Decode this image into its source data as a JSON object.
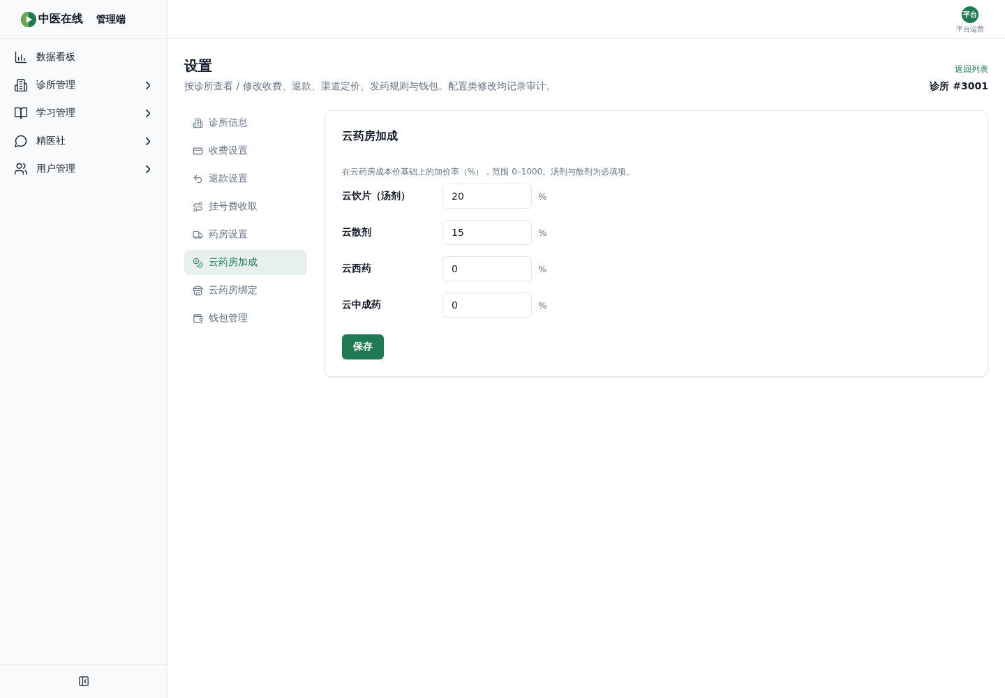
{
  "sidebar": {
    "brand": {
      "name": "中医在线",
      "suffix": "管理端"
    },
    "items": [
      {
        "label": "数据看板",
        "expandable": false
      },
      {
        "label": "诊所管理",
        "expandable": true
      },
      {
        "label": "学习管理",
        "expandable": true
      },
      {
        "label": "精医社",
        "expandable": true
      },
      {
        "label": "用户管理",
        "expandable": true
      }
    ]
  },
  "top_bar": {
    "avatar": {
      "badge": "平台",
      "role": "平台运营"
    }
  },
  "page": {
    "title": "设置",
    "subtitle": "按诊所查看 / 修改收费、退款、渠道定价、发药规则与钱包。配置类修改均记录审计。",
    "back_link": "返回列表",
    "clinic": "诊所 #3001"
  },
  "settings_nav": [
    {
      "label": "诊所信息",
      "selected": false
    },
    {
      "label": "收费设置",
      "selected": false
    },
    {
      "label": "退款设置",
      "selected": false
    },
    {
      "label": "挂号费收取",
      "selected": false
    },
    {
      "label": "药房设置",
      "selected": false
    },
    {
      "label": "云药房加成",
      "selected": true
    },
    {
      "label": "云药房绑定",
      "selected": false
    },
    {
      "label": "钱包管理",
      "selected": false
    }
  ],
  "panel": {
    "title": "云药房加成",
    "description": "在云药房成本价基础上的加价率（%），范围 0–1000。汤剂与散剂为必填项。",
    "fields": [
      {
        "label": "云饮片（汤剂）",
        "value": "20",
        "unit": "%"
      },
      {
        "label": "云散剂",
        "value": "15",
        "unit": "%"
      },
      {
        "label": "云西药",
        "value": "0",
        "unit": "%"
      },
      {
        "label": "云中成药",
        "value": "0",
        "unit": "%"
      }
    ],
    "save_button": "保存"
  }
}
